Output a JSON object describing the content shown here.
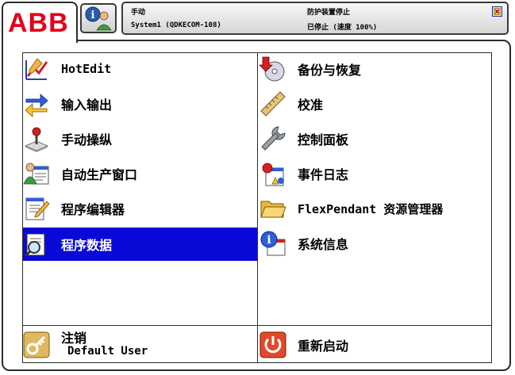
{
  "header": {
    "logo": "ABB",
    "status": {
      "mode": "手动",
      "system": "System1 (QDKECOM-108)",
      "safety": "防护装置停止",
      "state": "已停止 (速度 100%)"
    }
  },
  "menu": {
    "left": [
      {
        "label": "HotEdit",
        "icon": "hotedit-icon"
      },
      {
        "label": "输入输出",
        "icon": "io-arrows-icon"
      },
      {
        "label": "手动操纵",
        "icon": "joystick-icon"
      },
      {
        "label": "自动生产窗口",
        "icon": "auto-production-icon"
      },
      {
        "label": "程序编辑器",
        "icon": "program-editor-icon"
      },
      {
        "label": "程序数据",
        "icon": "program-data-icon",
        "selected": true
      }
    ],
    "right": [
      {
        "label": "备份与恢复",
        "icon": "backup-restore-icon"
      },
      {
        "label": "校准",
        "icon": "ruler-icon"
      },
      {
        "label": "控制面板",
        "icon": "wrench-icon"
      },
      {
        "label": "事件日志",
        "icon": "event-log-icon"
      },
      {
        "label": "FlexPendant 资源管理器",
        "icon": "folder-icon"
      },
      {
        "label": "系统信息",
        "icon": "info-icon"
      }
    ]
  },
  "footer": {
    "logoff_label": "注销",
    "user_label": "Default User",
    "restart_label": "重新启动"
  },
  "colors": {
    "brand": "#e2001a",
    "selection": "#0a0ad8"
  }
}
